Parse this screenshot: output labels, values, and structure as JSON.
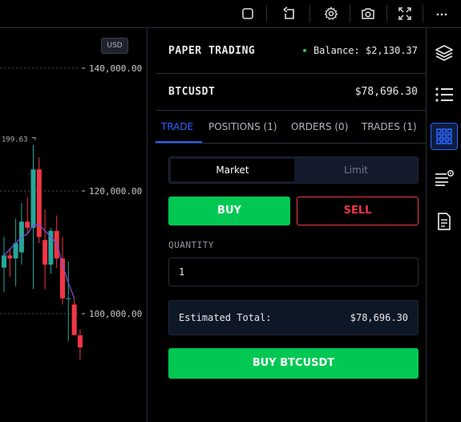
{
  "toolbar": {
    "icons": [
      "square-icon",
      "rotate-icon",
      "gear-icon",
      "camera-icon",
      "fullscreen-icon",
      "more-icon"
    ]
  },
  "chart": {
    "currency_badge": "USD",
    "price_labels": [
      "140,000.00",
      "120,000.00",
      "100,000.00"
    ],
    "high_label": "199.63"
  },
  "chart_data": {
    "type": "candlestick",
    "ylim": [
      92000,
      147000
    ],
    "y_ticks": [
      140000,
      120000,
      100000
    ],
    "candles": [
      {
        "o": 107500,
        "h": 112500,
        "l": 103500,
        "c": 109500
      },
      {
        "o": 109500,
        "h": 110500,
        "l": 106000,
        "c": 109000
      },
      {
        "o": 109000,
        "h": 115500,
        "l": 104500,
        "c": 111500
      },
      {
        "o": 110000,
        "h": 118000,
        "l": 108000,
        "c": 115000
      },
      {
        "o": 115000,
        "h": 119000,
        "l": 113000,
        "c": 114000
      },
      {
        "o": 114000,
        "h": 127500,
        "l": 104000,
        "c": 123500
      },
      {
        "o": 123500,
        "h": 125500,
        "l": 111500,
        "c": 112500
      },
      {
        "o": 112000,
        "h": 117000,
        "l": 104000,
        "c": 108000
      },
      {
        "o": 108000,
        "h": 114000,
        "l": 106500,
        "c": 113500
      },
      {
        "o": 113500,
        "h": 116000,
        "l": 107500,
        "c": 109000
      },
      {
        "o": 109000,
        "h": 112500,
        "l": 101500,
        "c": 102500
      },
      {
        "o": 102500,
        "h": 108500,
        "l": 95500,
        "c": 102500
      },
      {
        "o": 101500,
        "h": 102500,
        "l": 96500,
        "c": 96500
      },
      {
        "o": 96500,
        "h": 97500,
        "l": 92500,
        "c": 94500
      }
    ],
    "ma": [
      109500,
      110500,
      111500,
      112500,
      113000,
      114500,
      114500,
      113500,
      112500,
      111500,
      108000,
      105000,
      102500
    ],
    "colors": {
      "up": "#26a69a",
      "down": "#f23645",
      "ma": "#7b4fd6"
    }
  },
  "panel": {
    "mode": "PAPER TRADING",
    "balance": "Balance: $2,130.37",
    "symbol": "BTCUSDT",
    "symbol_price": "$78,696.30",
    "tabs": [
      "TRADE",
      "POSITIONS (1)",
      "ORDERS (0)",
      "TRADES (1)"
    ],
    "order_types": [
      "Market",
      "Limit"
    ],
    "buy_label": "BUY",
    "sell_label": "SELL",
    "quantity_label": "QUANTITY",
    "quantity_value": "1",
    "estimated_label": "Estimated Total:",
    "estimated_value": "$78,696.30",
    "submit_label": "BUY BTCUSDT"
  },
  "sidebar": {
    "icons": [
      "layers-icon",
      "list-icon",
      "grid-icon",
      "watchlist-alert-icon",
      "notes-icon"
    ],
    "active": "grid-icon"
  },
  "colors": {
    "accent": "#2962ff",
    "buy": "#00c853",
    "sell": "#f23645"
  }
}
